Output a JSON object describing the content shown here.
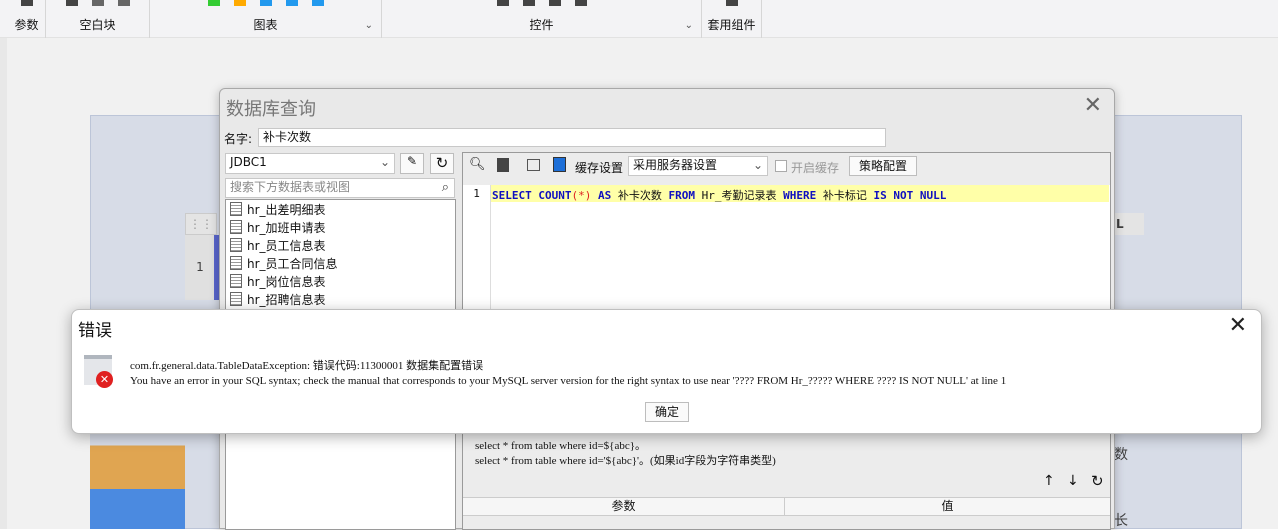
{
  "toolbar": {
    "groups": [
      {
        "label": "参数"
      },
      {
        "label": "空白块"
      },
      {
        "label": "图表"
      },
      {
        "label": "控件"
      },
      {
        "label": "套用组件"
      }
    ]
  },
  "report": {
    "row_number": "1",
    "col_header_right": "L",
    "side_labels": [
      "数",
      "长"
    ]
  },
  "db_dialog": {
    "title": "数据库查询",
    "name_label": "名字:",
    "name_value": "补卡次数",
    "datasource": "JDBC1",
    "search_placeholder": "搜索下方数据表或视图",
    "tables": [
      "hr_出差明细表",
      "hr_加班申请表",
      "hr_员工信息表",
      "hr_员工合同信息",
      "hr_岗位信息表",
      "hr_招聘信息表"
    ],
    "cache_label": "缓存设置",
    "cache_option": "采用服务器设置",
    "enable_cache_label": "开启缓存",
    "strategy_button": "策略配置",
    "sql": {
      "line_number": "1",
      "parts": [
        "SELECT",
        "COUNT",
        "(*)",
        "AS",
        "补卡次数",
        "FROM",
        "Hr_考勤记录表",
        "WHERE",
        "补卡标记",
        "IS NOT NULL"
      ]
    },
    "hints": [
      "select * from table where id=${abc}。",
      "select * from table where id='${abc}'。(如果id字段为字符串类型)"
    ],
    "param_headers": [
      "参数",
      "值"
    ]
  },
  "error_dialog": {
    "title": "错误",
    "line1": "com.fr.general.data.TableDataException: 错误代码:11300001 数据集配置错误",
    "line2": "You have an error in your SQL syntax; check the manual that corresponds to your MySQL server version for the right syntax to use near '???? FROM Hr_????? WHERE ???? IS NOT NULL' at line 1",
    "ok_button": "确定"
  }
}
